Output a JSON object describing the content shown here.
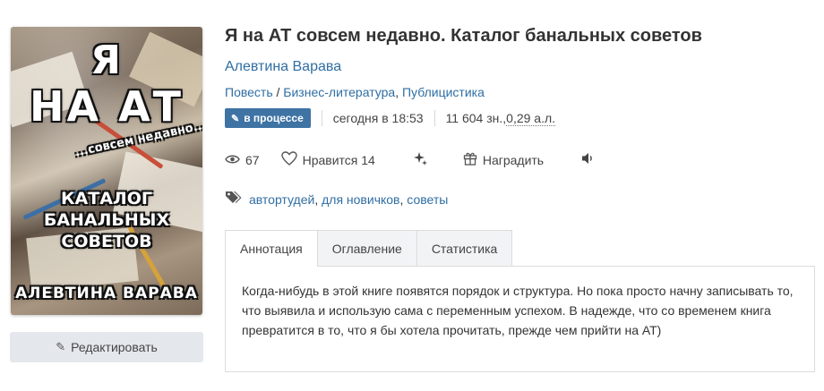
{
  "cover": {
    "line1": "Я",
    "line2": "НА АТ",
    "line3": "...совсем недавно...",
    "line4": "КАТАЛОГ БАНАЛЬНЫХ СОВЕТОВ",
    "line5": "АЛЕВТИНА ВАРАВА"
  },
  "edit_button": {
    "icon": "pencil-icon",
    "label": "Редактировать"
  },
  "book": {
    "title": "Я на АТ совсем недавно. Каталог банальных советов",
    "author": "Алевтина Варава",
    "genre_type": "Повесть",
    "genre_sep": " / ",
    "genre_1": "Бизнес-литература",
    "genre_comma": ", ",
    "genre_2": "Публицистика"
  },
  "meta": {
    "status_badge": "в процессе",
    "updated": "сегодня в 18:53",
    "size_chars": "11 604 зн., ",
    "size_sheets": "0,29 а.л."
  },
  "stats": {
    "views": "67",
    "likes_label": "Нравится",
    "likes_count": "14",
    "award_label": "Наградить"
  },
  "tags": [
    "автортудей",
    "для новичков",
    "советы"
  ],
  "tabs": [
    "Аннотация",
    "Оглавление",
    "Статистика"
  ],
  "annotation": "Когда-нибудь в этой книге появятся порядок и структура. Но пока просто начну записывать то, что выявила и использую сама с переменным успехом. В надежде, что со временем книга превратится в то, что я бы хотела прочитать, прежде чем прийти на АТ)",
  "colors": {
    "link": "#2f6ea3",
    "badge": "#3e73a4"
  }
}
